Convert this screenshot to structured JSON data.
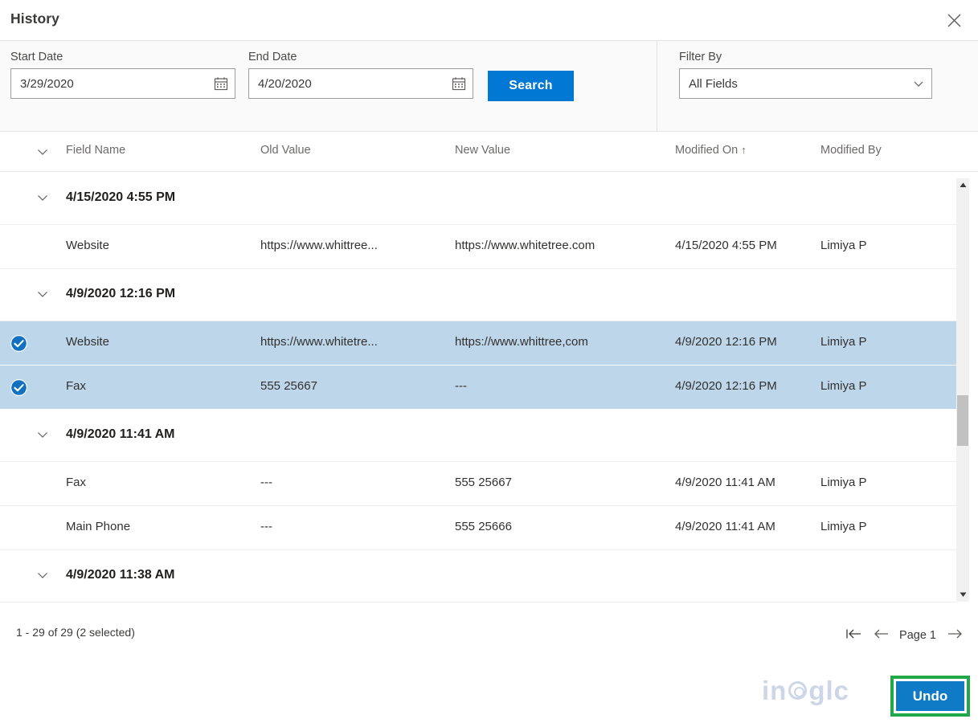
{
  "dialog": {
    "title": "History",
    "close_icon": "close-icon"
  },
  "filters": {
    "start_date": {
      "label": "Start Date",
      "value": "3/29/2020",
      "placeholder": "M/D/YYYY",
      "icon": "calendar-icon"
    },
    "end_date": {
      "label": "End Date",
      "value": "4/20/2020",
      "placeholder": "M/D/YYYY",
      "icon": "calendar-icon"
    },
    "search_button": "Search",
    "filter_by": {
      "label": "Filter By",
      "value": "All Fields",
      "icon": "chevron-down-icon"
    }
  },
  "table": {
    "expand_icon": "chevron-down-icon",
    "columns": [
      {
        "key": "field_name",
        "label": "Field Name",
        "sorted": false
      },
      {
        "key": "old_value",
        "label": "Old Value",
        "sorted": false
      },
      {
        "key": "new_value",
        "label": "New Value",
        "sorted": false
      },
      {
        "key": "modified_on",
        "label": "Modified On",
        "sorted": true,
        "sort_arrow": "↑"
      },
      {
        "key": "modified_by",
        "label": "Modified By",
        "sorted": false
      }
    ],
    "groups": [
      {
        "label": "4/15/2020 4:55 PM",
        "rows": [
          {
            "selected": false,
            "field_name": "Website",
            "old_value": "https://www.whittree...",
            "new_value": "https://www.whitetree.com",
            "modified_on": "4/15/2020 4:55 PM",
            "modified_by": "Limiya P"
          }
        ]
      },
      {
        "label": "4/9/2020 12:16 PM",
        "rows": [
          {
            "selected": true,
            "field_name": "Website",
            "old_value": "https://www.whitetre...",
            "new_value": "https://www.whittree,com",
            "modified_on": "4/9/2020 12:16 PM",
            "modified_by": "Limiya P"
          },
          {
            "selected": true,
            "field_name": "Fax",
            "old_value": "555 25667",
            "new_value": "---",
            "modified_on": "4/9/2020 12:16 PM",
            "modified_by": "Limiya P"
          }
        ]
      },
      {
        "label": "4/9/2020 11:41 AM",
        "rows": [
          {
            "selected": false,
            "field_name": "Fax",
            "old_value": "---",
            "new_value": "555 25667",
            "modified_on": "4/9/2020 11:41 AM",
            "modified_by": "Limiya P"
          },
          {
            "selected": false,
            "field_name": "Main Phone",
            "old_value": "---",
            "new_value": "555 25666",
            "modified_on": "4/9/2020 11:41 AM",
            "modified_by": "Limiya P"
          }
        ]
      },
      {
        "label": "4/9/2020 11:38 AM",
        "rows": []
      }
    ]
  },
  "footer": {
    "count_text": "1 - 29 of 29 (2 selected)",
    "pager": {
      "first_icon": "first-page-icon",
      "prev_icon": "previous-page-icon",
      "page_label": "Page 1",
      "next_icon": "next-page-icon"
    },
    "watermark": {
      "part1": "in",
      "part2": "g",
      "part3": "lc"
    },
    "undo_button": "Undo"
  },
  "colors": {
    "accent": "#0078d4",
    "undo_fill": "#0f7ac6",
    "highlight_outline": "#21a84b",
    "selected_row": "#bdd6ea",
    "watermark": "#ccd6e6"
  }
}
